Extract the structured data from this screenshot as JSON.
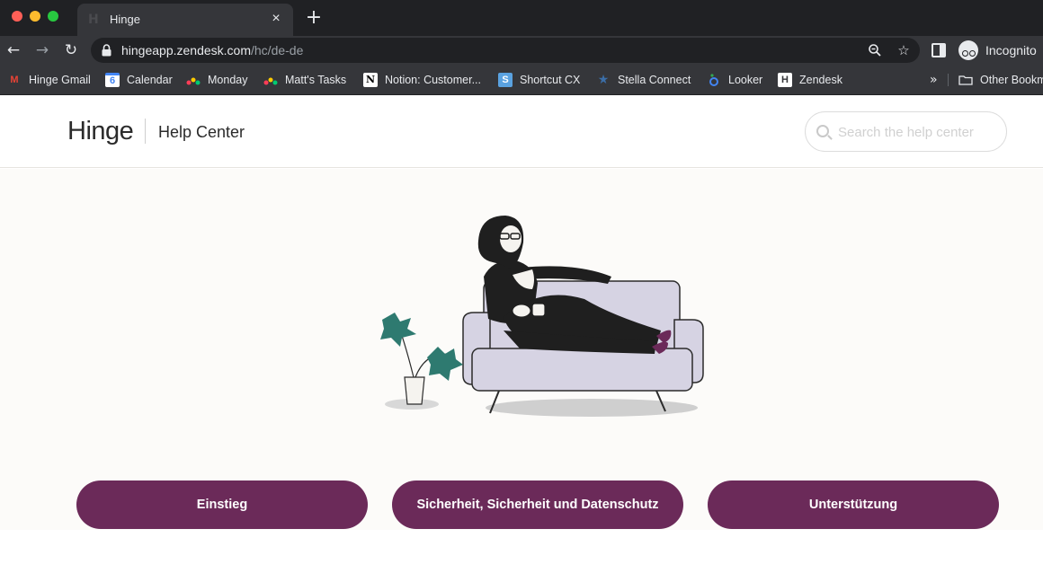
{
  "browser": {
    "tab_title": "Hinge",
    "tab_close": "×",
    "new_tab": "+",
    "url_host": "hingeapp.zendesk.com",
    "url_path": "/hc/de-de",
    "profile_label": "Incognito",
    "bookmarks": [
      {
        "label": "Hinge Gmail",
        "icon": "gmail-icon",
        "glyph": "M",
        "color": "#ea4335"
      },
      {
        "label": "Calendar",
        "icon": "calendar-icon",
        "glyph": "6",
        "color": "#4285f4"
      },
      {
        "label": "Monday",
        "icon": "monday-icon",
        "glyph": "",
        "color": "#ff3d57"
      },
      {
        "label": "Matt's Tasks",
        "icon": "monday-icon",
        "glyph": "",
        "color": "#ff3d57"
      },
      {
        "label": "Notion: Customer...",
        "icon": "notion-icon",
        "glyph": "N",
        "color": "#ffffff"
      },
      {
        "label": "Shortcut CX",
        "icon": "shortcut-icon",
        "glyph": "S",
        "color": "#5aa2e0"
      },
      {
        "label": "Stella Connect",
        "icon": "star-icon",
        "glyph": "★",
        "color": "#3b6ea8"
      },
      {
        "label": "Looker",
        "icon": "looker-icon",
        "glyph": "◦",
        "color": "#4285f4"
      },
      {
        "label": "Zendesk",
        "icon": "zendesk-icon",
        "glyph": "H",
        "color": "#ffffff"
      }
    ],
    "more_bookmarks": "»",
    "other_bookmarks": "Other Bookm"
  },
  "header": {
    "logo": "Hinge",
    "title": "Help Center",
    "search_placeholder": "Search the help center"
  },
  "categories": [
    {
      "label": "Einstieg"
    },
    {
      "label": "Sicherheit, Sicherheit und Datenschutz"
    },
    {
      "label": "Unterstützung"
    }
  ],
  "colors": {
    "accent": "#6b2a59",
    "sofa": "#d6d3e3",
    "plant": "#2e7a70",
    "hero_bg": "#fcfbf9"
  }
}
